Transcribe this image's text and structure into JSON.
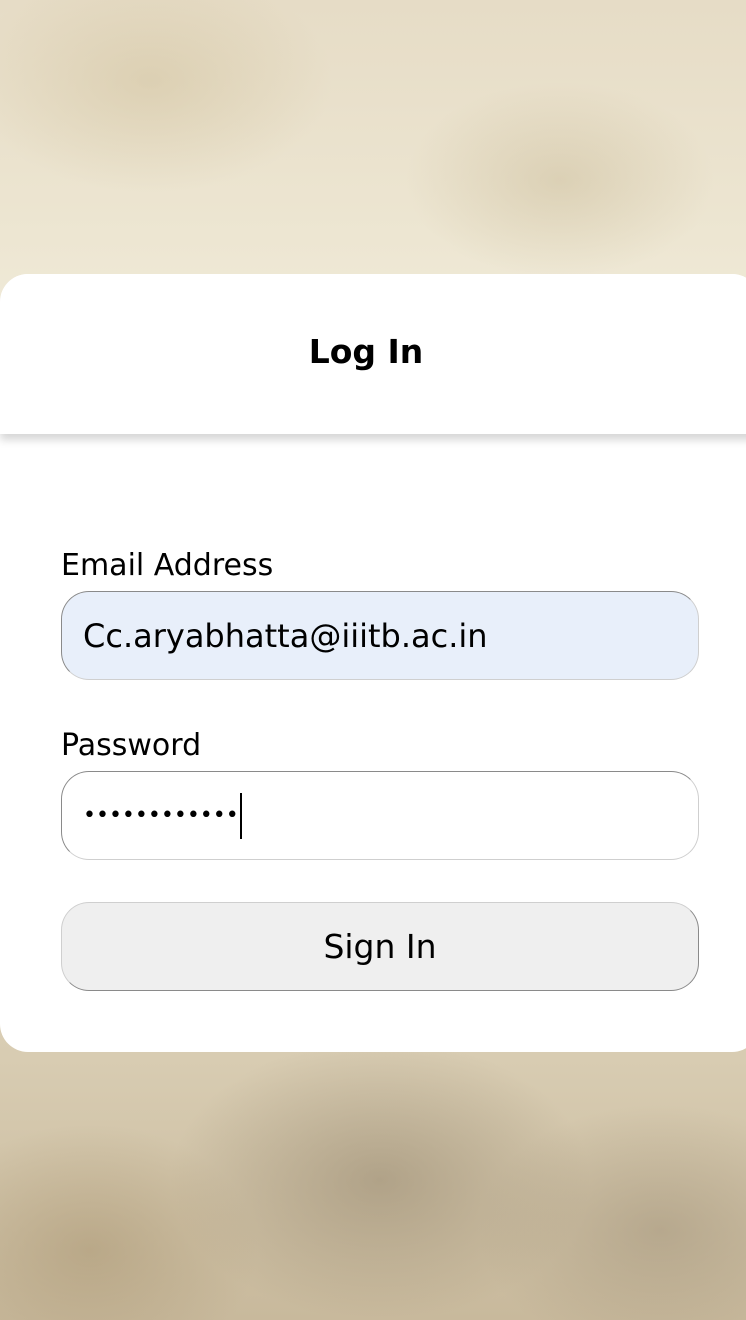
{
  "login": {
    "title": "Log In",
    "email_label": "Email Address",
    "email_value": "Cc.aryabhatta@iiitb.ac.in",
    "password_label": "Password",
    "password_masked": "••••••••••••",
    "signin_label": "Sign In"
  },
  "colors": {
    "card_background": "#ffffff",
    "email_field_background": "#e8effa",
    "button_background": "#efefef"
  }
}
